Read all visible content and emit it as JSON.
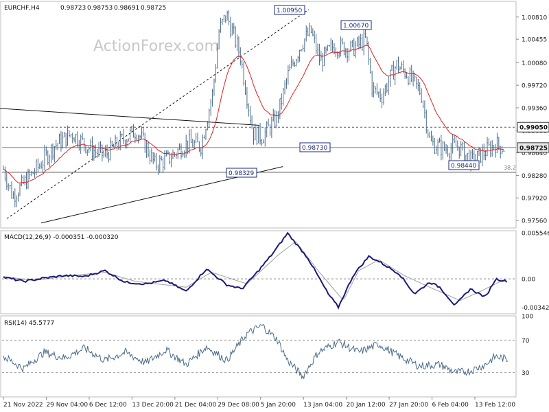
{
  "chart_data": [
    {
      "type": "candlestick",
      "panel": "price",
      "symbol_label": "EURCHF,H4",
      "ohlc_readout": [
        "0.98723",
        "0.98753",
        "0.98691",
        "0.98725"
      ],
      "watermark": "ActionForex.com",
      "y_ticks": [
        "1.00810",
        "1.00455",
        "1.00080",
        "0.99720",
        "0.99360",
        "0.99000",
        "0.98640",
        "0.98280",
        "0.97920",
        "0.97560"
      ],
      "ylim": [
        0.9744,
        1.0106
      ],
      "x_ticks": [
        "21 Nov 2022",
        "29 Nov 04:00",
        "6 Dec 12:00",
        "13 Dec 20:00",
        "21 Dec 04:00",
        "29 Dec 08:00",
        "5 Jan 20:00",
        "13 Jan 04:00",
        "20 Jan 12:00",
        "27 Jan 20:00",
        "6 Feb 04:00",
        "13 Feb 12:00"
      ],
      "bar_count": 305,
      "close_anchors": [
        [
          0,
          0.9838
        ],
        [
          10,
          0.9795
        ],
        [
          25,
          0.982
        ],
        [
          40,
          0.9845
        ],
        [
          55,
          0.9875
        ],
        [
          75,
          0.9895
        ],
        [
          95,
          0.987
        ],
        [
          110,
          0.986
        ],
        [
          130,
          0.9885
        ],
        [
          145,
          0.99
        ],
        [
          155,
          0.9875
        ],
        [
          165,
          0.9845
        ],
        [
          180,
          0.9855
        ],
        [
          200,
          0.988
        ],
        [
          215,
          0.9875
        ],
        [
          228,
          0.996
        ],
        [
          235,
          1.006
        ],
        [
          243,
          1.0085
        ],
        [
          258,
          1.002
        ],
        [
          272,
          0.9895
        ],
        [
          282,
          0.989
        ],
        [
          298,
          0.992
        ],
        [
          310,
          0.9988
        ],
        [
          325,
          1.004
        ],
        [
          335,
          1.0058
        ],
        [
          345,
          1.001
        ],
        [
          360,
          1.0035
        ],
        [
          380,
          1.003
        ],
        [
          395,
          1.0045
        ],
        [
          402,
          0.9965
        ],
        [
          412,
          0.9955
        ],
        [
          428,
          1.0005
        ],
        [
          440,
          0.999
        ],
        [
          455,
          0.996
        ],
        [
          465,
          0.988
        ],
        [
          480,
          0.987
        ],
        [
          495,
          0.9875
        ],
        [
          510,
          0.985
        ],
        [
          525,
          0.9866
        ],
        [
          536,
          0.9878
        ],
        [
          545,
          0.9872
        ]
      ],
      "moving_average": {
        "color": "#e02020"
      },
      "candle_color": "#4a6b8a",
      "price_labels": [
        {
          "text": "1.00950",
          "price": 1.0095
        },
        {
          "text": "1.00670",
          "price": 1.0067
        },
        {
          "text": "0.98730",
          "price": 0.9873
        },
        {
          "text": "0.98329",
          "price": 0.98329
        },
        {
          "text": "0.98440",
          "price": 0.9844
        }
      ],
      "horizontal_levels": [
        {
          "price": 0.9905,
          "style": "dashed",
          "label": "0.99050"
        },
        {
          "price": 0.98725,
          "style": "solid",
          "label": "0.98725",
          "current": true
        },
        {
          "price": 0.9833,
          "style": "solid",
          "label": "38.2"
        }
      ],
      "trendlines": [
        {
          "style": "solid",
          "note": "descending resistance"
        },
        {
          "style": "dashed",
          "note": "rising channel"
        },
        {
          "style": "solid",
          "note": "rising support"
        }
      ]
    },
    {
      "type": "line",
      "panel": "macd",
      "label": "MACD(12,26,9) -0.000351 -0.000320",
      "y_ticks": [
        "0.005546",
        "0.00",
        "-0.003423"
      ],
      "ylim": [
        -0.0042,
        0.0058
      ],
      "series": [
        {
          "role": "macd",
          "color": "#1a1a7a",
          "anchors": [
            [
              0,
              0.0002
            ],
            [
              20,
              -0.0003
            ],
            [
              40,
              0.0001
            ],
            [
              60,
              0.0004
            ],
            [
              80,
              0.0003
            ],
            [
              100,
              0.001
            ],
            [
              120,
              -0.0004
            ],
            [
              140,
              -0.0006
            ],
            [
              160,
              -0.0002
            ],
            [
              180,
              -0.0015
            ],
            [
              200,
              0.0012
            ],
            [
              220,
              -0.0007
            ],
            [
              235,
              -0.0012
            ],
            [
              250,
              0.0008
            ],
            [
              265,
              0.003
            ],
            [
              280,
              0.0055
            ],
            [
              300,
              0.0025
            ],
            [
              320,
              -0.0018
            ],
            [
              330,
              -0.0034
            ],
            [
              345,
              0.0005
            ],
            [
              360,
              0.0027
            ],
            [
              370,
              0.0021
            ],
            [
              390,
              0.0006
            ],
            [
              405,
              -0.0018
            ],
            [
              420,
              -0.0004
            ],
            [
              430,
              -0.001
            ],
            [
              445,
              -0.0032
            ],
            [
              460,
              -0.0012
            ],
            [
              475,
              -0.0022
            ],
            [
              485,
              0.0
            ],
            [
              497,
              -0.0003
            ]
          ]
        },
        {
          "role": "signal",
          "color": "#a0a0a0",
          "anchors": [
            [
              0,
              0.0003
            ],
            [
              30,
              -0.0002
            ],
            [
              60,
              0.0003
            ],
            [
              100,
              0.0008
            ],
            [
              130,
              -0.0003
            ],
            [
              180,
              -0.001
            ],
            [
              205,
              0.0008
            ],
            [
              240,
              -0.0006
            ],
            [
              270,
              0.0028
            ],
            [
              288,
              0.0045
            ],
            [
              310,
              0.001
            ],
            [
              335,
              -0.0026
            ],
            [
              350,
              0.001
            ],
            [
              370,
              0.0023
            ],
            [
              395,
              0.0004
            ],
            [
              420,
              -0.001
            ],
            [
              450,
              -0.0026
            ],
            [
              470,
              -0.0015
            ],
            [
              490,
              -0.0003
            ]
          ]
        }
      ]
    },
    {
      "type": "line",
      "panel": "rsi",
      "label": "RSI(14) 45.5777",
      "y_ticks": [
        "100",
        "70",
        "30",
        "0"
      ],
      "ylim": [
        0,
        100
      ],
      "series": [
        {
          "role": "rsi",
          "color": "#4a6b8a",
          "anchors": [
            [
              0,
              50
            ],
            [
              20,
              35
            ],
            [
              40,
              55
            ],
            [
              60,
              48
            ],
            [
              80,
              60
            ],
            [
              100,
              45
            ],
            [
              120,
              55
            ],
            [
              140,
              42
            ],
            [
              160,
              58
            ],
            [
              180,
              40
            ],
            [
              200,
              62
            ],
            [
              220,
              45
            ],
            [
              240,
              78
            ],
            [
              255,
              88
            ],
            [
              270,
              70
            ],
            [
              280,
              45
            ],
            [
              295,
              25
            ],
            [
              310,
              55
            ],
            [
              330,
              68
            ],
            [
              350,
              55
            ],
            [
              370,
              65
            ],
            [
              390,
              50
            ],
            [
              410,
              38
            ],
            [
              430,
              40
            ],
            [
              445,
              30
            ],
            [
              460,
              32
            ],
            [
              475,
              40
            ],
            [
              485,
              50
            ],
            [
              497,
              46
            ]
          ]
        }
      ]
    }
  ]
}
